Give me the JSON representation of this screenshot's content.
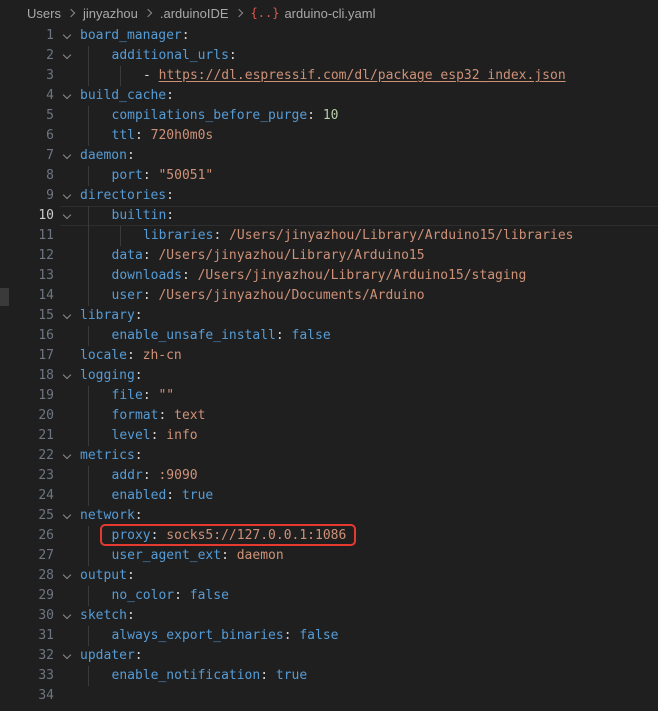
{
  "breadcrumb": {
    "items": [
      "Users",
      "jinyazhou",
      ".arduinoIDE"
    ],
    "file_icon": "{..}",
    "file_name": "arduino-cli.yaml"
  },
  "editor": {
    "active_line": 10,
    "lines": [
      {
        "n": "1",
        "indent": 0,
        "fold": true,
        "tokens": [
          {
            "t": "board_manager",
            "c": "k"
          },
          {
            "t": ":",
            "c": "p"
          }
        ]
      },
      {
        "n": "2",
        "indent": 1,
        "fold": true,
        "tokens": [
          {
            "t": "additional_urls",
            "c": "k"
          },
          {
            "t": ":",
            "c": "p"
          }
        ]
      },
      {
        "n": "3",
        "indent": 2,
        "fold": false,
        "tokens": [
          {
            "t": "- ",
            "c": "p"
          },
          {
            "t": "https://dl.espressif.com/dl/package_esp32_index.json",
            "c": "url"
          }
        ]
      },
      {
        "n": "4",
        "indent": 0,
        "fold": true,
        "tokens": [
          {
            "t": "build_cache",
            "c": "k"
          },
          {
            "t": ":",
            "c": "p"
          }
        ]
      },
      {
        "n": "5",
        "indent": 1,
        "fold": false,
        "tokens": [
          {
            "t": "compilations_before_purge",
            "c": "k"
          },
          {
            "t": ": ",
            "c": "p"
          },
          {
            "t": "10",
            "c": "n"
          }
        ]
      },
      {
        "n": "6",
        "indent": 1,
        "fold": false,
        "tokens": [
          {
            "t": "ttl",
            "c": "k"
          },
          {
            "t": ": ",
            "c": "p"
          },
          {
            "t": "720h0m0s",
            "c": "s"
          }
        ]
      },
      {
        "n": "7",
        "indent": 0,
        "fold": true,
        "tokens": [
          {
            "t": "daemon",
            "c": "k"
          },
          {
            "t": ":",
            "c": "p"
          }
        ]
      },
      {
        "n": "8",
        "indent": 1,
        "fold": false,
        "tokens": [
          {
            "t": "port",
            "c": "k"
          },
          {
            "t": ": ",
            "c": "p"
          },
          {
            "t": "\"50051\"",
            "c": "s"
          }
        ]
      },
      {
        "n": "9",
        "indent": 0,
        "fold": true,
        "tokens": [
          {
            "t": "directories",
            "c": "k"
          },
          {
            "t": ":",
            "c": "p"
          }
        ]
      },
      {
        "n": "10",
        "indent": 1,
        "fold": true,
        "tokens": [
          {
            "t": "builtin",
            "c": "k"
          },
          {
            "t": ":",
            "c": "p"
          }
        ]
      },
      {
        "n": "11",
        "indent": 2,
        "fold": false,
        "tokens": [
          {
            "t": "libraries",
            "c": "k"
          },
          {
            "t": ": ",
            "c": "p"
          },
          {
            "t": "/Users/jinyazhou/Library/Arduino15/libraries",
            "c": "s"
          }
        ]
      },
      {
        "n": "12",
        "indent": 1,
        "fold": false,
        "tokens": [
          {
            "t": "data",
            "c": "k"
          },
          {
            "t": ": ",
            "c": "p"
          },
          {
            "t": "/Users/jinyazhou/Library/Arduino15",
            "c": "s"
          }
        ]
      },
      {
        "n": "13",
        "indent": 1,
        "fold": false,
        "tokens": [
          {
            "t": "downloads",
            "c": "k"
          },
          {
            "t": ": ",
            "c": "p"
          },
          {
            "t": "/Users/jinyazhou/Library/Arduino15/staging",
            "c": "s"
          }
        ]
      },
      {
        "n": "14",
        "indent": 1,
        "fold": false,
        "tokens": [
          {
            "t": "user",
            "c": "k"
          },
          {
            "t": ": ",
            "c": "p"
          },
          {
            "t": "/Users/jinyazhou/Documents/Arduino",
            "c": "s"
          }
        ]
      },
      {
        "n": "15",
        "indent": 0,
        "fold": true,
        "tokens": [
          {
            "t": "library",
            "c": "k"
          },
          {
            "t": ":",
            "c": "p"
          }
        ]
      },
      {
        "n": "16",
        "indent": 1,
        "fold": false,
        "tokens": [
          {
            "t": "enable_unsafe_install",
            "c": "k"
          },
          {
            "t": ": ",
            "c": "p"
          },
          {
            "t": "false",
            "c": "k"
          }
        ]
      },
      {
        "n": "17",
        "indent": 0,
        "fold": false,
        "tokens": [
          {
            "t": "locale",
            "c": "k"
          },
          {
            "t": ": ",
            "c": "p"
          },
          {
            "t": "zh-cn",
            "c": "s"
          }
        ]
      },
      {
        "n": "18",
        "indent": 0,
        "fold": true,
        "tokens": [
          {
            "t": "logging",
            "c": "k"
          },
          {
            "t": ":",
            "c": "p"
          }
        ]
      },
      {
        "n": "19",
        "indent": 1,
        "fold": false,
        "tokens": [
          {
            "t": "file",
            "c": "k"
          },
          {
            "t": ": ",
            "c": "p"
          },
          {
            "t": "\"\"",
            "c": "s"
          }
        ]
      },
      {
        "n": "20",
        "indent": 1,
        "fold": false,
        "tokens": [
          {
            "t": "format",
            "c": "k"
          },
          {
            "t": ": ",
            "c": "p"
          },
          {
            "t": "text",
            "c": "s"
          }
        ]
      },
      {
        "n": "21",
        "indent": 1,
        "fold": false,
        "tokens": [
          {
            "t": "level",
            "c": "k"
          },
          {
            "t": ": ",
            "c": "p"
          },
          {
            "t": "info",
            "c": "s"
          }
        ]
      },
      {
        "n": "22",
        "indent": 0,
        "fold": true,
        "tokens": [
          {
            "t": "metrics",
            "c": "k"
          },
          {
            "t": ":",
            "c": "p"
          }
        ]
      },
      {
        "n": "23",
        "indent": 1,
        "fold": false,
        "tokens": [
          {
            "t": "addr",
            "c": "k"
          },
          {
            "t": ": ",
            "c": "p"
          },
          {
            "t": ":9090",
            "c": "s"
          }
        ]
      },
      {
        "n": "24",
        "indent": 1,
        "fold": false,
        "tokens": [
          {
            "t": "enabled",
            "c": "k"
          },
          {
            "t": ": ",
            "c": "p"
          },
          {
            "t": "true",
            "c": "k"
          }
        ]
      },
      {
        "n": "25",
        "indent": 0,
        "fold": true,
        "tokens": [
          {
            "t": "network",
            "c": "k"
          },
          {
            "t": ":",
            "c": "p"
          }
        ]
      },
      {
        "n": "26",
        "indent": 1,
        "fold": false,
        "tokens": [
          {
            "t": "proxy",
            "c": "k"
          },
          {
            "t": ": ",
            "c": "p"
          },
          {
            "t": "socks5://127.0.0.1:1086",
            "c": "s"
          }
        ]
      },
      {
        "n": "27",
        "indent": 1,
        "fold": false,
        "tokens": [
          {
            "t": "user_agent_ext",
            "c": "k"
          },
          {
            "t": ": ",
            "c": "p"
          },
          {
            "t": "daemon",
            "c": "s"
          }
        ]
      },
      {
        "n": "28",
        "indent": 0,
        "fold": true,
        "tokens": [
          {
            "t": "output",
            "c": "k"
          },
          {
            "t": ":",
            "c": "p"
          }
        ]
      },
      {
        "n": "29",
        "indent": 1,
        "fold": false,
        "tokens": [
          {
            "t": "no_color",
            "c": "k"
          },
          {
            "t": ": ",
            "c": "p"
          },
          {
            "t": "false",
            "c": "k"
          }
        ]
      },
      {
        "n": "30",
        "indent": 0,
        "fold": true,
        "tokens": [
          {
            "t": "sketch",
            "c": "k"
          },
          {
            "t": ":",
            "c": "p"
          }
        ]
      },
      {
        "n": "31",
        "indent": 1,
        "fold": false,
        "tokens": [
          {
            "t": "always_export_binaries",
            "c": "k"
          },
          {
            "t": ": ",
            "c": "p"
          },
          {
            "t": "false",
            "c": "k"
          }
        ]
      },
      {
        "n": "32",
        "indent": 0,
        "fold": true,
        "tokens": [
          {
            "t": "updater",
            "c": "k"
          },
          {
            "t": ":",
            "c": "p"
          }
        ]
      },
      {
        "n": "33",
        "indent": 1,
        "fold": false,
        "tokens": [
          {
            "t": "enable_notification",
            "c": "k"
          },
          {
            "t": ": ",
            "c": "p"
          },
          {
            "t": "true",
            "c": "k"
          }
        ]
      },
      {
        "n": "34",
        "indent": 0,
        "fold": false,
        "tokens": []
      }
    ]
  },
  "colors": {
    "key": "#569cd6",
    "string": "#ce9178",
    "number": "#b5cea8",
    "highlight_box": "#e53a30",
    "background": "#1f1f1f"
  }
}
